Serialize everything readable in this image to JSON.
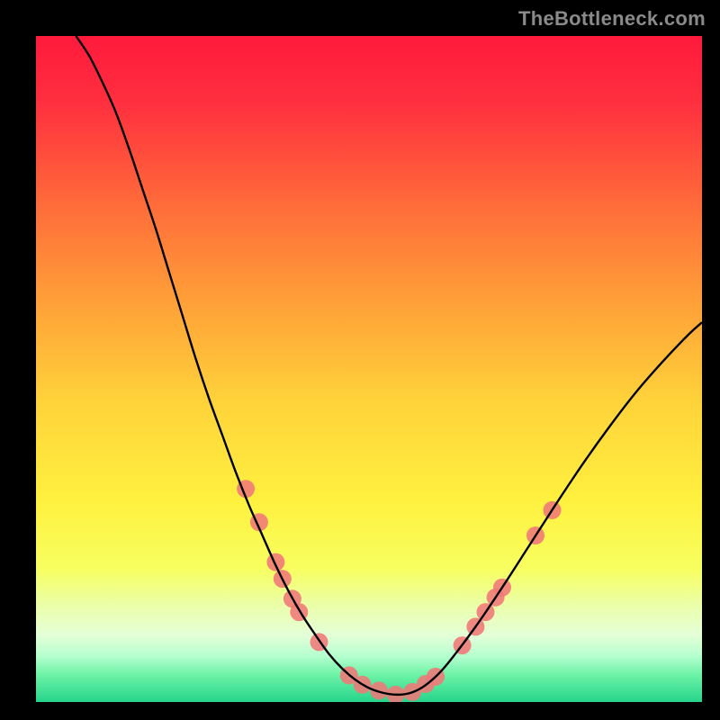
{
  "watermark": "TheBottleneck.com",
  "chart_data": {
    "type": "line",
    "title": "",
    "xlabel": "",
    "ylabel": "",
    "xlim": [
      0,
      100
    ],
    "ylim": [
      0,
      100
    ],
    "grid": false,
    "legend": false,
    "background_gradient_stops": [
      {
        "pos": 0.0,
        "color": "#ff1a3c"
      },
      {
        "pos": 0.1,
        "color": "#ff2f3f"
      },
      {
        "pos": 0.25,
        "color": "#ff6a3a"
      },
      {
        "pos": 0.4,
        "color": "#ffa038"
      },
      {
        "pos": 0.55,
        "color": "#ffd33a"
      },
      {
        "pos": 0.7,
        "color": "#fff13f"
      },
      {
        "pos": 0.8,
        "color": "#f7ff60"
      },
      {
        "pos": 0.86,
        "color": "#eaffb0"
      },
      {
        "pos": 0.9,
        "color": "#e4ffd8"
      },
      {
        "pos": 0.93,
        "color": "#b7ffcf"
      },
      {
        "pos": 0.96,
        "color": "#6bf2a6"
      },
      {
        "pos": 1.0,
        "color": "#25d58b"
      }
    ],
    "series": [
      {
        "name": "bottleneck-curve",
        "color": "#000000",
        "stroke_width": 2.4,
        "x": [
          6,
          8,
          10,
          12,
          14,
          16,
          18,
          20,
          22,
          24,
          26,
          28,
          30,
          32,
          34,
          36,
          38,
          40,
          42,
          44,
          46,
          48,
          50,
          52,
          54,
          56,
          58,
          60,
          62,
          66,
          70,
          74,
          78,
          82,
          86,
          90,
          94,
          98,
          100
        ],
        "y": [
          100,
          97,
          93,
          88.5,
          83,
          77,
          71,
          64.5,
          58,
          51.5,
          45.5,
          40,
          34.5,
          29.5,
          25,
          20.5,
          16.5,
          13,
          10,
          7.2,
          5,
          3.3,
          2.1,
          1.4,
          1.1,
          1.3,
          2.2,
          3.8,
          6,
          11.3,
          17.2,
          23.4,
          29.6,
          35.6,
          41.2,
          46.4,
          51,
          55.2,
          57
        ]
      }
    ],
    "scatter": [
      {
        "name": "highlight-dots",
        "color": "#f07878",
        "radius": 10,
        "points": [
          {
            "x": 31.5,
            "y": 32
          },
          {
            "x": 33.5,
            "y": 27
          },
          {
            "x": 36,
            "y": 21
          },
          {
            "x": 37,
            "y": 18.5
          },
          {
            "x": 38.5,
            "y": 15.5
          },
          {
            "x": 39.5,
            "y": 13.5
          },
          {
            "x": 42.5,
            "y": 9
          },
          {
            "x": 47,
            "y": 4
          },
          {
            "x": 49,
            "y": 2.6
          },
          {
            "x": 51.5,
            "y": 1.7
          },
          {
            "x": 54,
            "y": 1.1
          },
          {
            "x": 56.5,
            "y": 1.5
          },
          {
            "x": 58.5,
            "y": 2.7
          },
          {
            "x": 60,
            "y": 3.8
          },
          {
            "x": 64,
            "y": 8.5
          },
          {
            "x": 66,
            "y": 11.3
          },
          {
            "x": 67.5,
            "y": 13.5
          },
          {
            "x": 69,
            "y": 15.7
          },
          {
            "x": 70,
            "y": 17.2
          },
          {
            "x": 75,
            "y": 25
          },
          {
            "x": 77.5,
            "y": 28.8
          }
        ]
      }
    ]
  }
}
